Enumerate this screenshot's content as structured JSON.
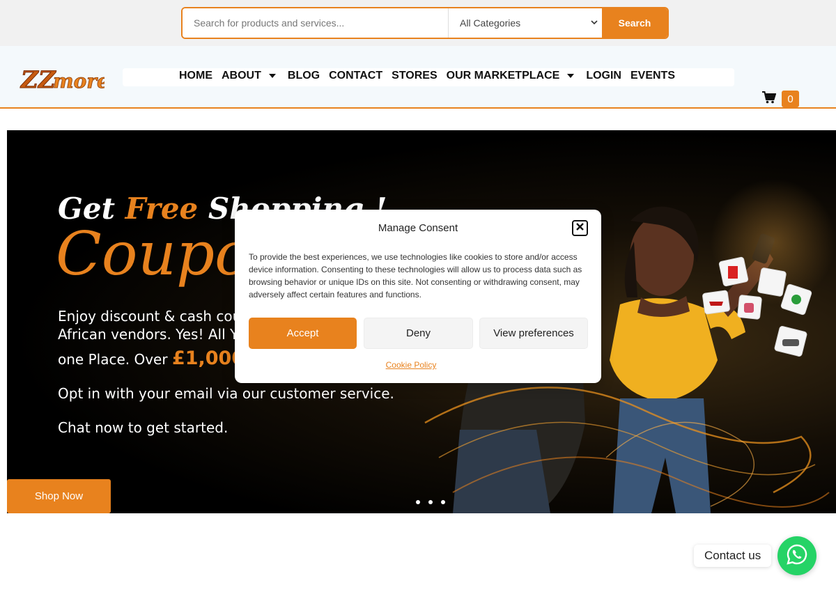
{
  "search": {
    "placeholder": "Search for products and services...",
    "category": "All Categories",
    "button": "Search"
  },
  "header": {
    "logo_text": "ZZmore",
    "nav": [
      {
        "label": "HOME",
        "dropdown": false
      },
      {
        "label": "ABOUT",
        "dropdown": true
      },
      {
        "label": "BLOG",
        "dropdown": false
      },
      {
        "label": "CONTACT",
        "dropdown": false
      },
      {
        "label": "STORES",
        "dropdown": false
      },
      {
        "label": "OUR MARKETPLACE",
        "dropdown": true
      },
      {
        "label": "LOGIN",
        "dropdown": false
      },
      {
        "label": "EVENTS",
        "dropdown": false
      }
    ],
    "cart_count": "0",
    "cart_icon": "shopping-cart-icon"
  },
  "hero": {
    "line1_a": "Get ",
    "line1_b": "Free",
    "line1_c": " Shopping !",
    "line2": "Coupon",
    "p1": "Enjoy discount & cash cou",
    "p2": "African vendors. Yes! All Yo",
    "p3_a": "one Place. Over ",
    "p3_amount": "£1,000",
    "p4": "Opt in with your email via our customer service.",
    "p5": "Chat now to get started.",
    "shop_now": "Shop Now",
    "slides": 3
  },
  "consent": {
    "title": "Manage Consent",
    "body": "To provide the best experiences, we use technologies like cookies to store and/or access device information. Consenting to these technologies will allow us to process data such as browsing behavior or unique IDs on this site. Not consenting or withdrawing consent, may adversely affect certain features and functions.",
    "accept": "Accept",
    "deny": "Deny",
    "preferences": "View preferences",
    "cookie_policy": "Cookie Policy"
  },
  "contact": {
    "label": "Contact us",
    "icon": "whatsapp-icon"
  },
  "colors": {
    "accent": "#e8821e",
    "whatsapp": "#25d366"
  }
}
